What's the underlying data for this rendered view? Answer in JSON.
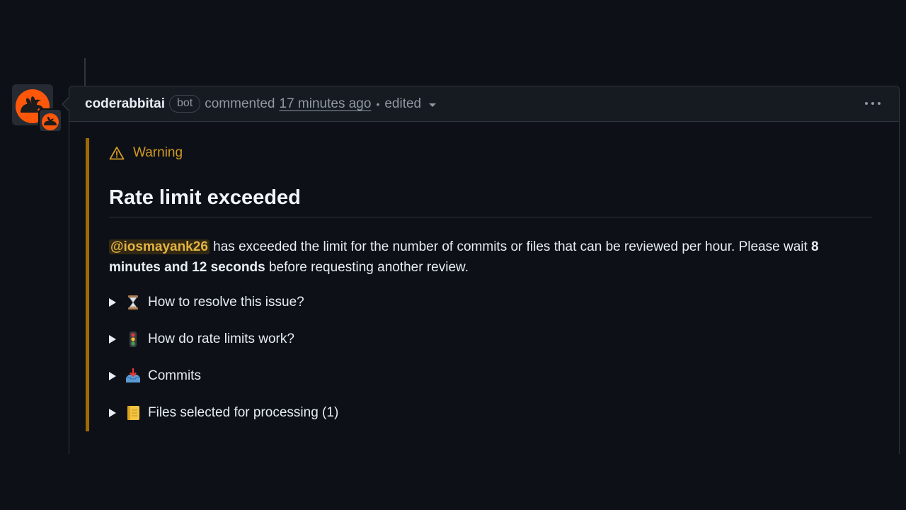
{
  "comment": {
    "author": "coderabbitai",
    "badge": "bot",
    "action": "commented",
    "time": "17 minutes ago",
    "separator": "•",
    "edited": "edited"
  },
  "callout": {
    "type": "Warning",
    "color": "#d29922",
    "border_color": "#9e6a03"
  },
  "body": {
    "heading": "Rate limit exceeded",
    "mention": "@iosmayank26",
    "text_1": " has exceeded the limit for the number of commits or files that can be reviewed per hour. Please wait ",
    "bold_wait": "8 minutes and 12 seconds",
    "text_2": " before requesting another review."
  },
  "details": [
    {
      "icon": "hourglass-icon",
      "label": "How to resolve this issue?"
    },
    {
      "icon": "traffic-light-icon",
      "label": "How do rate limits work?"
    },
    {
      "icon": "inbox-tray-icon",
      "label": "Commits"
    },
    {
      "icon": "ledger-icon",
      "label": "Files selected for processing (1)"
    }
  ],
  "colors": {
    "background": "#0d1117",
    "header_bg": "#161b22",
    "border": "#30363d",
    "muted_text": "#9198a1",
    "mention_text": "#e3b341",
    "brand_orange": "#ff570a"
  }
}
